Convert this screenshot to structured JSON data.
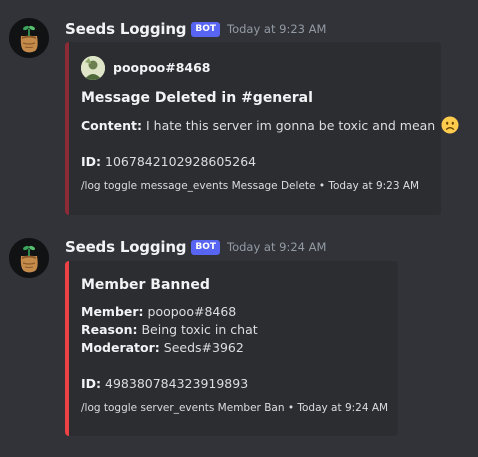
{
  "messages": [
    {
      "username": "Seeds Logging",
      "bot_tag": "BOT",
      "timestamp": "Today at 9:23 AM",
      "embed": {
        "accent": "#8b2b35",
        "author": "poopoo#8468",
        "title": "Message Deleted in #general",
        "content_label": "Content:",
        "content_text": "I hate this server im gonna be toxic and mean",
        "id_label": "ID:",
        "id_value": "1067842102928605264",
        "footer_text": "/log toggle message_events Message Delete • Today at 9:23 AM"
      }
    },
    {
      "username": "Seeds Logging",
      "bot_tag": "BOT",
      "timestamp": "Today at 9:24 AM",
      "embed": {
        "accent": "#ed4245",
        "title": "Member Banned",
        "member_label": "Member:",
        "member_value": "poopoo#8468",
        "reason_label": "Reason:",
        "reason_value": "Being toxic in chat",
        "moderator_label": "Moderator:",
        "moderator_value": "Seeds#3962",
        "id_label": "ID:",
        "id_value": "498380784323919893",
        "footer_text": "/log toggle server_events Member Ban • Today at 9:24 AM"
      }
    }
  ],
  "icons": {
    "avatar": "seed-bag-icon",
    "author": "user-avatar-icon",
    "emoji": "frowning-face-icon"
  }
}
